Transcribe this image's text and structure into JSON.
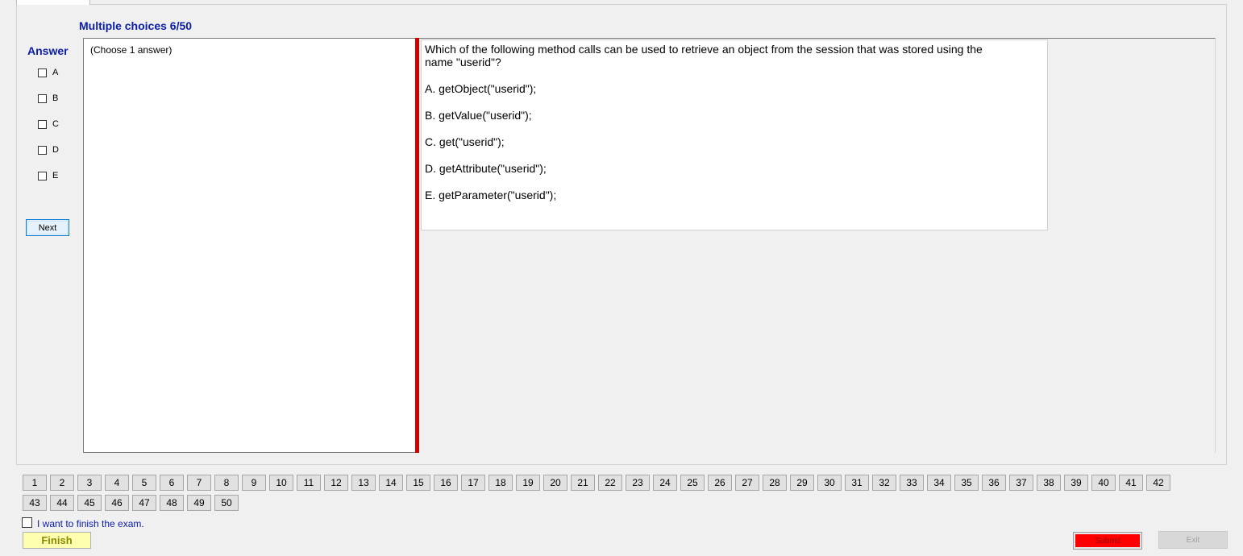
{
  "header": {
    "section_title": "Multiple choices 6/50"
  },
  "answer_panel": {
    "label": "Answer",
    "options": [
      "A",
      "B",
      "C",
      "D",
      "E"
    ],
    "next_label": "Next"
  },
  "left_pane": {
    "instruction": "(Choose 1 answer)"
  },
  "question": {
    "text": "Which of the following method calls can be used to retrieve an object from the session that was stored using the name \"userid\"?",
    "choices": [
      "A.  getObject(\"userid\");",
      "B.  getValue(\"userid\");",
      "C.  get(\"userid\");",
      "D.  getAttribute(\"userid\");",
      "E.  getParameter(\"userid\");"
    ]
  },
  "navigation": {
    "row1": [
      "1",
      "2",
      "3",
      "4",
      "5",
      "6",
      "7",
      "8",
      "9",
      "10",
      "11",
      "12",
      "13",
      "14",
      "15",
      "16",
      "17",
      "18",
      "19",
      "20",
      "21",
      "22",
      "23",
      "24",
      "25",
      "26",
      "27",
      "28",
      "29",
      "30",
      "31",
      "32",
      "33",
      "34",
      "35",
      "36",
      "37",
      "38",
      "39",
      "40",
      "41",
      "42"
    ],
    "row2": [
      "43",
      "44",
      "45",
      "46",
      "47",
      "48",
      "49",
      "50"
    ]
  },
  "footer": {
    "finish_checkbox_label": "I want to finish the exam.",
    "finish_label": "Finish",
    "submit_label": "Submit",
    "exit_label": "Exit"
  },
  "colors": {
    "accent_text": "#0a1ea8",
    "splitter": "#d40000",
    "submit_bg": "#ff0000",
    "finish_bg": "#ffffb0"
  }
}
